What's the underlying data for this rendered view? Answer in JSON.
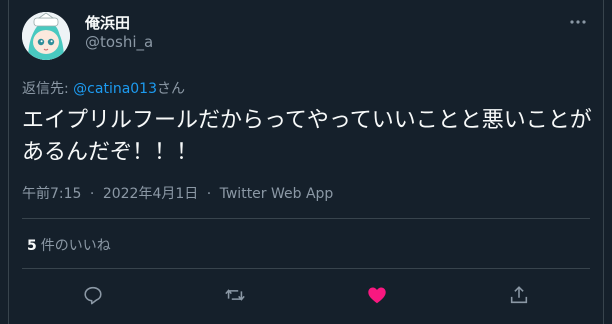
{
  "author": {
    "display_name": "俺浜田",
    "handle": "@toshi_a"
  },
  "reply": {
    "prefix": "返信先: ",
    "mention": "@catina013",
    "suffix": "さん"
  },
  "tweet": {
    "text": "エイプリルフールだからってやっていいことと悪いことがあるんだぞ！！！"
  },
  "meta": {
    "time": "午前7:15",
    "separator": "·",
    "date": "2022年4月1日",
    "source": "Twitter Web App"
  },
  "stats": {
    "likes_count": "5",
    "likes_label": "件のいいね"
  },
  "actions": [
    {
      "name": "reply",
      "icon": "reply-icon"
    },
    {
      "name": "retweet",
      "icon": "retweet-icon"
    },
    {
      "name": "like",
      "icon": "heart-icon",
      "active": true,
      "color": "#f91880"
    },
    {
      "name": "share",
      "icon": "share-icon"
    }
  ],
  "colors": {
    "background": "#15202b",
    "accent": "#1d9bf0",
    "secondary_text": "#8b98a5",
    "border": "#38444d"
  }
}
